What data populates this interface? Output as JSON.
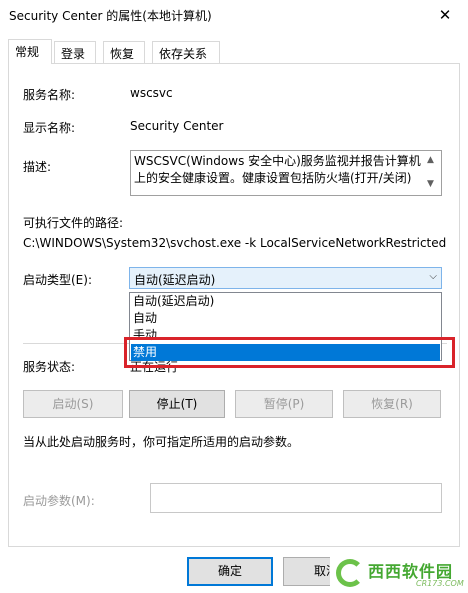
{
  "window": {
    "title": "Security Center 的属性(本地计算机)",
    "close_glyph": "✕"
  },
  "tabs": [
    {
      "label": "常规"
    },
    {
      "label": "登录"
    },
    {
      "label": "恢复"
    },
    {
      "label": "依存关系"
    }
  ],
  "general": {
    "service_name_label": "服务名称:",
    "service_name_value": "wscsvc",
    "display_name_label": "显示名称:",
    "display_name_value": "Security Center",
    "description_label": "描述:",
    "description_line1": "WSCSVC(Windows 安全中心)服务监视并报告计算机",
    "description_line2": "上的安全健康设置。健康设置包括防火墙(打开/关闭)",
    "exe_path_label": "可执行文件的路径:",
    "exe_path_value": "C:\\WINDOWS\\System32\\svchost.exe -k LocalServiceNetworkRestricted",
    "startup_type_label": "启动类型(E):",
    "startup_type_value": "自动(延迟启动)",
    "startup_options": [
      "自动(延迟启动)",
      "自动",
      "手动",
      "禁用"
    ],
    "service_status_label": "服务状态:",
    "service_status_value": "正在运行",
    "buttons": {
      "start": "启动(S)",
      "stop": "停止(T)",
      "pause": "暂停(P)",
      "resume": "恢复(R)"
    },
    "hint_text": "当从此处启动服务时，你可指定所适用的启动参数。",
    "start_params_label": "启动参数(M):",
    "start_params_value": ""
  },
  "footer": {
    "ok": "确定",
    "cancel": "取消"
  },
  "watermark": {
    "main": "西西软件园",
    "sub": "CR173.COM"
  },
  "icons": {
    "dropdown_arrow": "chevron-down",
    "scroll_up": "triangle-up",
    "scroll_down": "triangle-down"
  }
}
